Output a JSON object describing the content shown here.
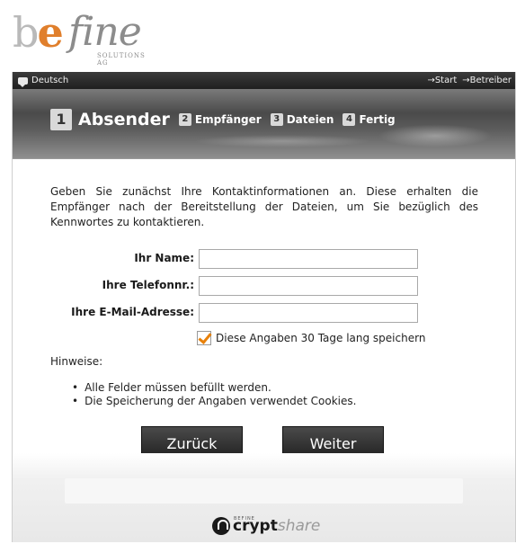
{
  "logo": {
    "be_b": "b",
    "be_e": "e",
    "fine": "fine",
    "subtitle": "SOLUTIONS AG"
  },
  "topbar": {
    "language": "Deutsch",
    "links": [
      "→Start",
      "→Betreiber"
    ]
  },
  "steps": [
    {
      "number": "1",
      "label": "Absender",
      "active": true
    },
    {
      "number": "2",
      "label": "Empfänger",
      "active": false
    },
    {
      "number": "3",
      "label": "Dateien",
      "active": false
    },
    {
      "number": "4",
      "label": "Fertig",
      "active": false
    }
  ],
  "intro": "Geben Sie zunächst Ihre Kontaktinformationen an. Diese erhalten die Empfänger nach der Bereitstellung der Dateien, um Sie bezüglich des Kennwortes zu kontaktieren.",
  "form": {
    "name_label": "Ihr Name:",
    "name_value": "",
    "phone_label": "Ihre Telefonnr.:",
    "phone_value": "",
    "email_label": "Ihre E-Mail-Adresse:",
    "email_value": "",
    "remember_label": "Diese Angaben 30 Tage lang speichern",
    "remember_checked": true
  },
  "hints": {
    "title": "Hinweise:",
    "items": [
      "Alle Felder müssen befüllt werden.",
      "Die Speicherung der Angaben verwendet Cookies."
    ]
  },
  "buttons": {
    "back": "Zurück",
    "next": "Weiter"
  },
  "footer": {
    "brand_small": "BEFINE",
    "brand_crypt": "crypt",
    "brand_share": "share"
  },
  "colors": {
    "accent_orange": "#e07f2c",
    "checkmark": "#e8810a",
    "topbar": "#2a2a2a"
  }
}
